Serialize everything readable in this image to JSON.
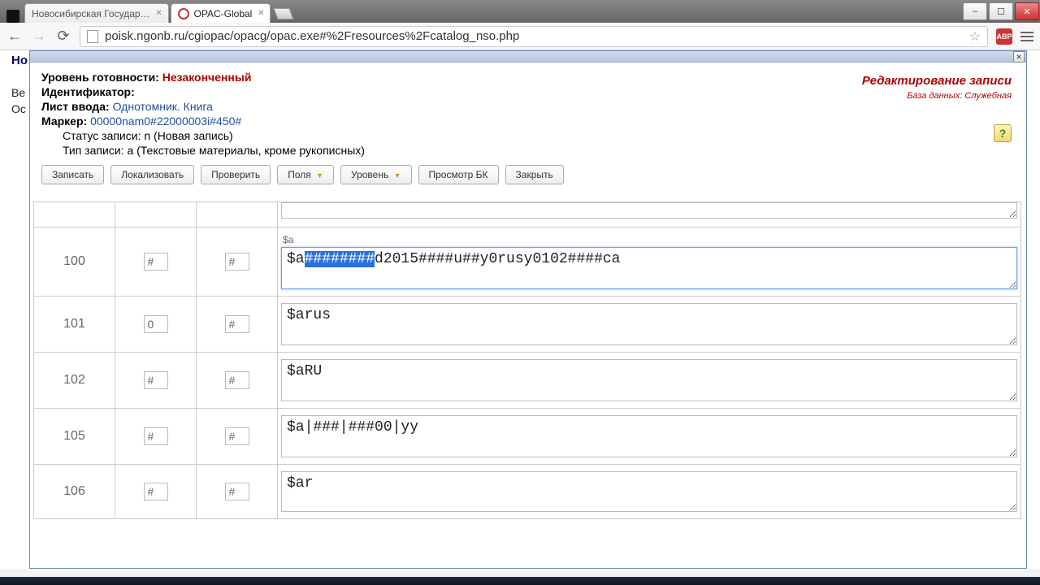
{
  "browser": {
    "tabs": [
      {
        "title": "Новосибирская Государ…",
        "active": false
      },
      {
        "title": "OPAC-Global",
        "active": true
      }
    ],
    "url": "poisk.ngonb.ru/cgiopac/opacg/opac.exe#%2Fresources%2Fcatalog_nso.php"
  },
  "background": {
    "line1": "Но",
    "line2": "Ве",
    "line3": "Ос"
  },
  "header": {
    "ready_label": "Уровень готовности:",
    "ready_value": "Незаконченный",
    "id_label": "Идентификатор:",
    "list_label": "Лист ввода:",
    "list_value": "Однотомник. Книга",
    "marker_label": "Маркер:",
    "marker_value": "00000nam0#22000003i#450#",
    "status_label": "Статус записи:",
    "status_value": "n (Новая запись)",
    "type_label": "Тип записи:",
    "type_value": "a (Текстовые материалы, кроме рукописных)",
    "right_title": "Редактирование записи",
    "right_db": "База данных: Служебная"
  },
  "toolbar": {
    "save": "Записать",
    "localize": "Локализовать",
    "check": "Проверить",
    "fields": "Поля",
    "level": "Уровень",
    "preview": "Просмотр БК",
    "close": "Закрыть"
  },
  "grid": {
    "first_placeholder_row": {
      "tag": "",
      "ind1": "",
      "ind2": "",
      "value": ""
    },
    "rows": [
      {
        "tag": "100",
        "ind1": "#",
        "ind2": "#",
        "label": "$a",
        "value_pre": "$a",
        "value_sel": "########",
        "value_post": "d2015####u##y0rusy0102####ca",
        "focused": true
      },
      {
        "tag": "101",
        "ind1": "0",
        "ind2": "#",
        "value": "$arus"
      },
      {
        "tag": "102",
        "ind1": "#",
        "ind2": "#",
        "value": "$aRU"
      },
      {
        "tag": "105",
        "ind1": "#",
        "ind2": "#",
        "value": "$a|###|###00|yy"
      },
      {
        "tag": "106",
        "ind1": "#",
        "ind2": "#",
        "value": "$ar"
      }
    ]
  }
}
